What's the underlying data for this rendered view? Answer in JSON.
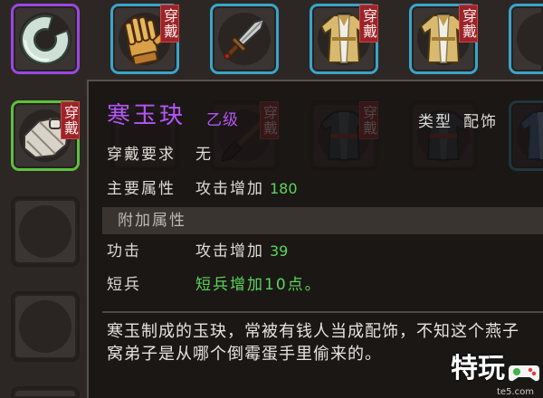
{
  "inventory": {
    "equip_tag": "穿戴",
    "slots": [
      {
        "icon": "jade-ring-icon",
        "frame_color": "#9b47e3",
        "equipped": false
      },
      {
        "icon": "glove-icon",
        "frame_color": "#3ba4c9",
        "equipped": true
      },
      {
        "icon": "dagger-icon",
        "frame_color": "#3ba4c9",
        "equipped": false
      },
      {
        "icon": "robe-icon",
        "frame_color": "#3ba4c9",
        "equipped": true
      },
      {
        "icon": "robe-icon",
        "frame_color": "#3ba4c9",
        "equipped": true
      },
      {
        "frame_color": "#3ba4c9",
        "equipped": false
      },
      {
        "icon": "bandage-icon",
        "frame_color": "#5cc03d",
        "equipped": true
      },
      {
        "equipped": false
      },
      {
        "icon": "brush-icon",
        "equipped": true
      },
      {
        "icon": "dark-robe-icon",
        "equipped": true
      },
      {
        "icon": "dark-robe-icon",
        "equipped": false
      },
      {
        "icon": "blue-robe-icon",
        "frame_color": "#3ba4c9",
        "equipped": false
      },
      {
        "equipped": false
      },
      {
        "equipped": false
      },
      {
        "equipped": false
      }
    ]
  },
  "tooltip": {
    "item_name": "寒玉玦",
    "grade": "乙级",
    "type_label": "类型",
    "type_value": "配饰",
    "requirement": {
      "label": "穿戴要求",
      "value": "无"
    },
    "main_attribute": {
      "label": "主要属性",
      "text": "攻击增加",
      "amount": 180
    },
    "extra_header": "附加属性",
    "extra_attributes": [
      {
        "label": "功击",
        "text": "攻击增加",
        "amount": 39
      },
      {
        "label": "短兵",
        "text": "短兵增加10点。"
      }
    ],
    "description": [
      "寒玉制成的玉玦，常被有钱人当成配饰，不知这个燕子",
      "窝弟子是从哪个倒霉蛋手里偷来的。"
    ]
  },
  "watermark": {
    "brand": "特玩",
    "site": "te5.com"
  },
  "colors": {
    "item_name": "#b455f6",
    "bonus_text": "#5ad65a",
    "equip_tag": "#9c2327"
  }
}
